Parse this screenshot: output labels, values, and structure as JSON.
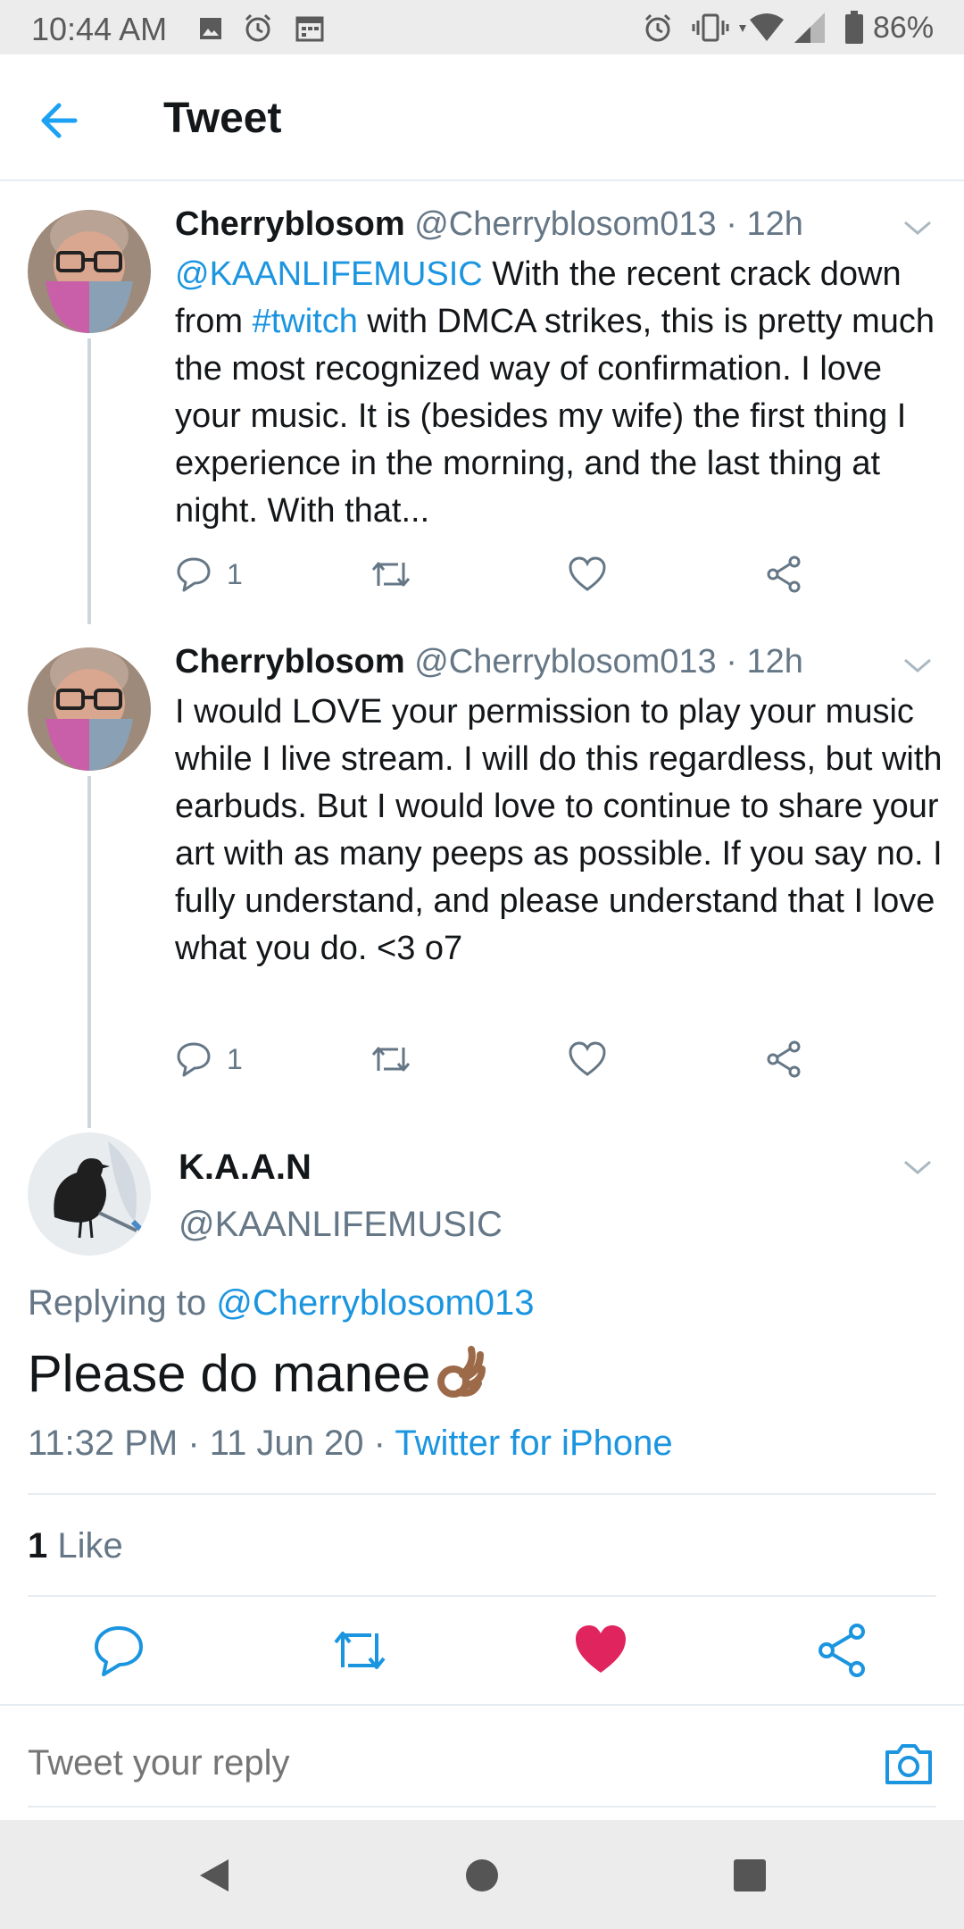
{
  "status_bar": {
    "time": "10:44 AM",
    "battery": "86%",
    "icons": [
      "image-icon",
      "alarm-icon",
      "calendar-icon",
      "alarm-icon",
      "vibrate-icon",
      "wifi-icon",
      "signal-icon",
      "battery-icon"
    ]
  },
  "app_bar": {
    "title": "Tweet",
    "back_icon": "arrow-left-icon"
  },
  "thread": [
    {
      "name": "Cherryblosom",
      "handle": "@Cherryblosom013",
      "time": "· 12h",
      "text_parts": {
        "mention": "@KAANLIFEMUSIC",
        "t1": " With the recent crack down from ",
        "hashtag": "#twitch",
        "t2": " with DMCA strikes, this is pretty much the most recognized way of confirmation. I love your music. It is (besides my wife) the first thing I experience in the morning, and the last thing at night. With that..."
      },
      "reply_count": "1"
    },
    {
      "name": "Cherryblosom",
      "handle": "@Cherryblosom013",
      "time": "· 12h",
      "text": "I would LOVE your permission to play your music while I live stream. I will do this regardless, but with earbuds. But I would love to continue to share your art with as many peeps as possible. If you say no. I fully understand, and please understand that I love what you do. <3 o7",
      "reply_count": "1"
    }
  ],
  "main_tweet": {
    "name": "K.A.A.N",
    "handle": "@KAANLIFEMUSIC",
    "replying_prefix": "Replying to ",
    "replying_to": "@Cherryblosom013",
    "text": "Please do manee",
    "emoji": "👌",
    "timestamp": "11:32 PM · 11 Jun 20 · ",
    "source": "Twitter for iPhone",
    "likes_count": "1",
    "likes_label": " Like",
    "liked": true
  },
  "reply_bar": {
    "placeholder": "Tweet your reply"
  },
  "colors": {
    "link": "#1b95e0",
    "secondary": "#657786",
    "like_red": "#e0245e",
    "divider": "#e6ecf0"
  }
}
